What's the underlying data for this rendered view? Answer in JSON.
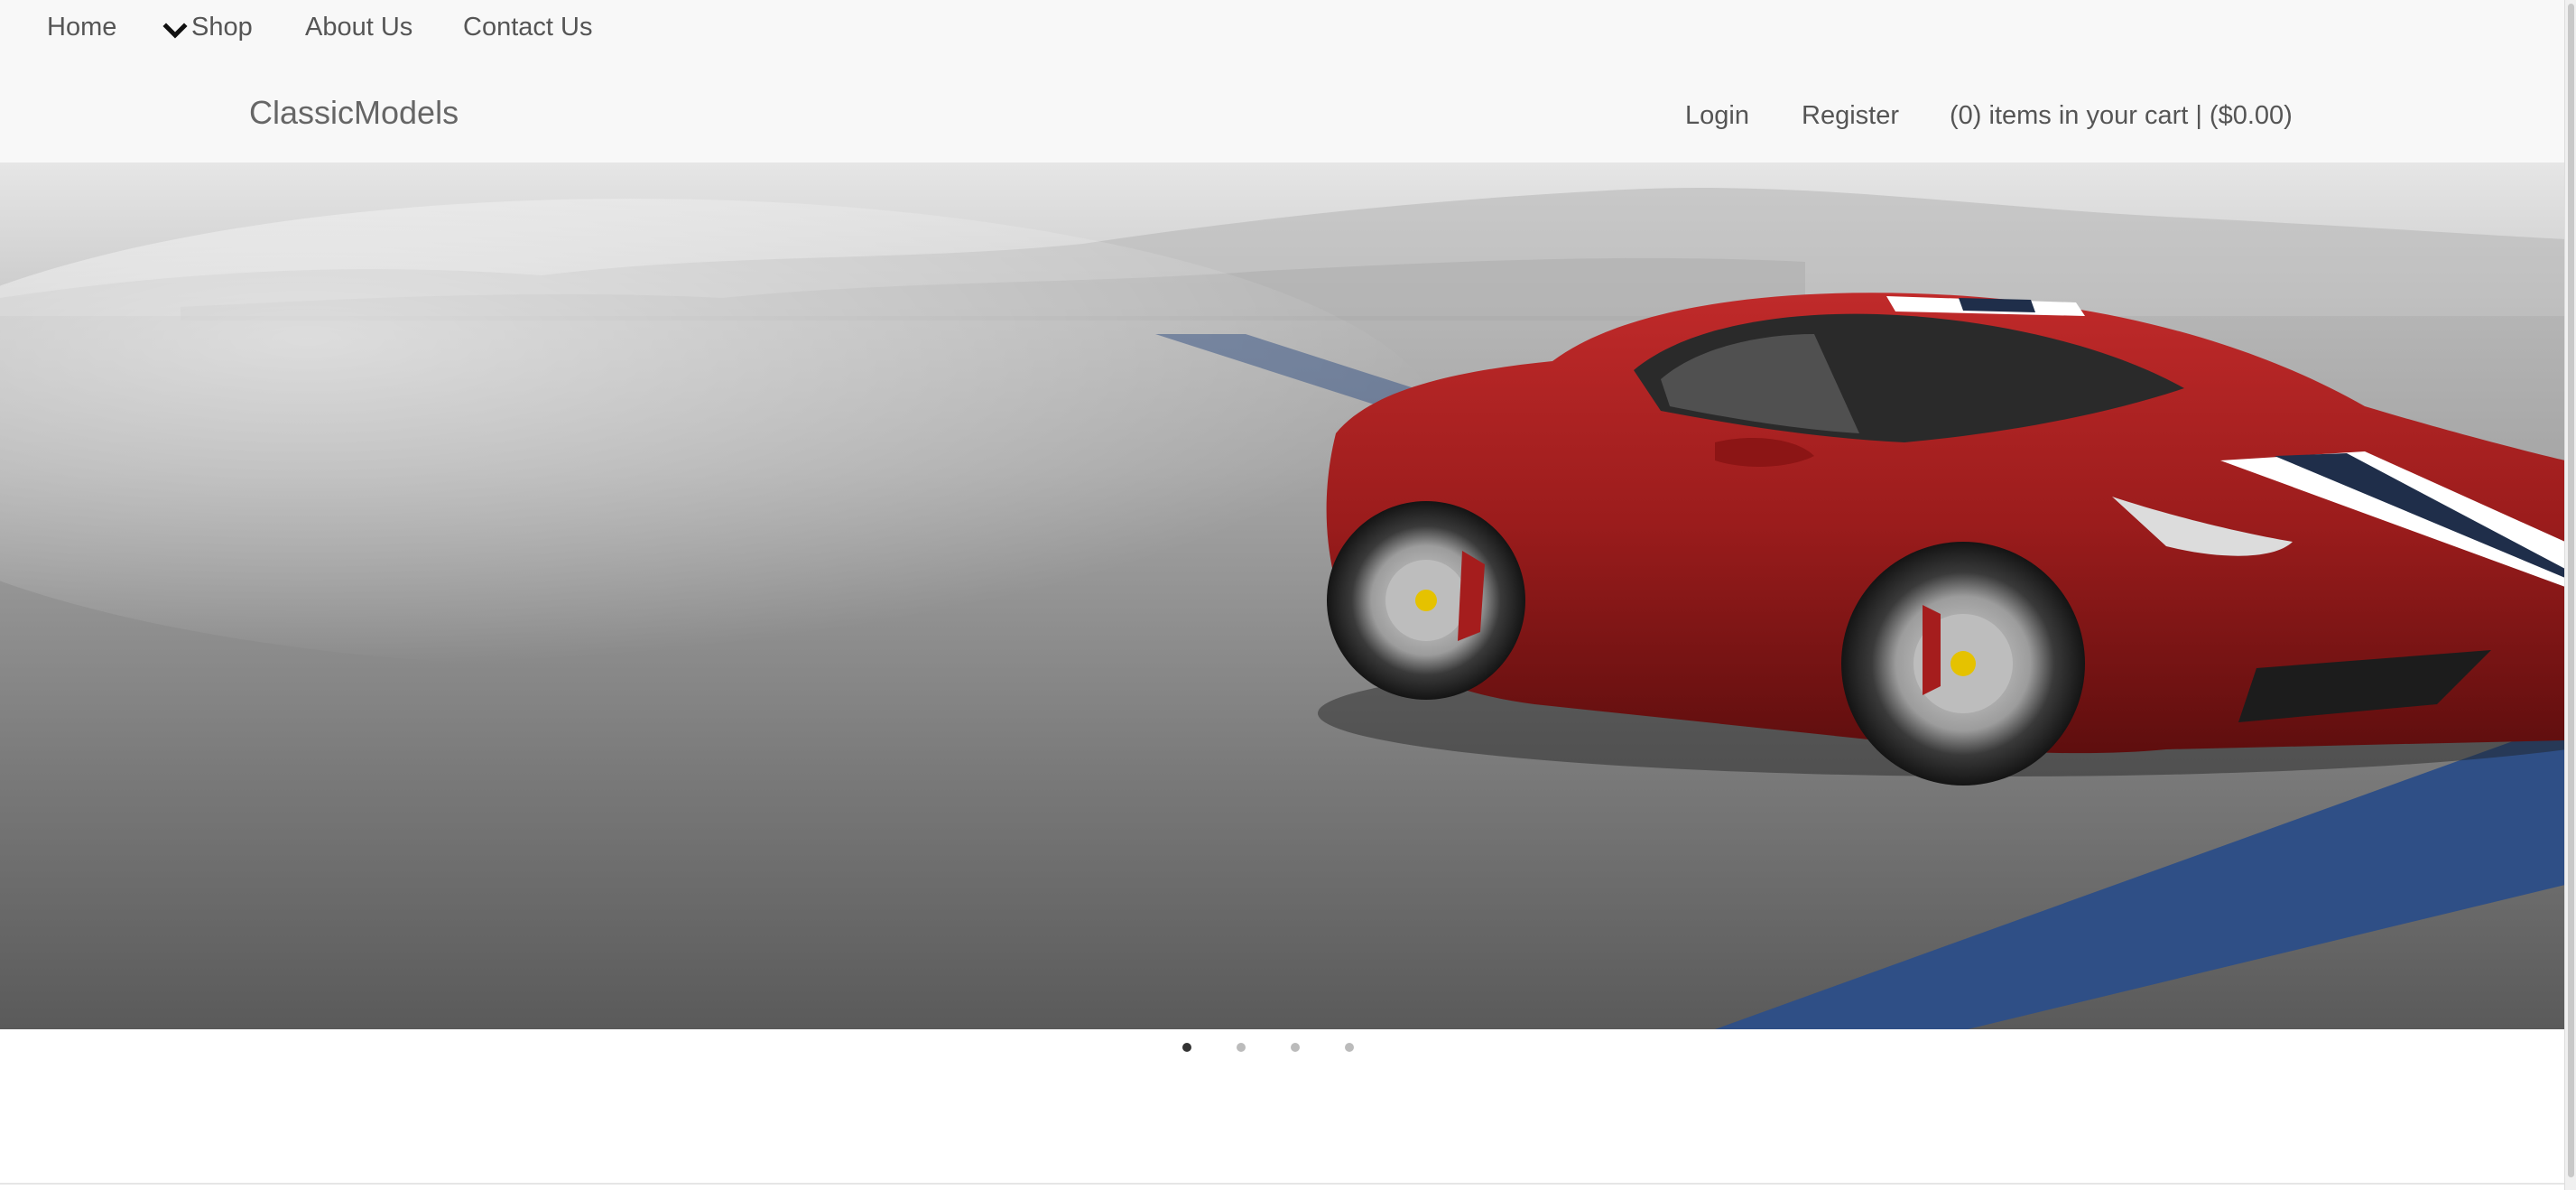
{
  "top_nav": {
    "home": "Home",
    "shop": "Shop",
    "about": "About Us",
    "contact": "Contact Us",
    "shop_icon": "chevron-down-icon"
  },
  "header": {
    "brand": "ClassicModels",
    "login": "Login",
    "register": "Register",
    "cart": "(0) items in your cart | ($0.00)"
  },
  "carousel": {
    "slide_count": 4,
    "active_index": 0
  },
  "colors": {
    "car_red": "#9e1b1b",
    "track_blue": "#2f4f86",
    "nav_bg": "#f8f8f8",
    "nav_text": "#555555"
  }
}
